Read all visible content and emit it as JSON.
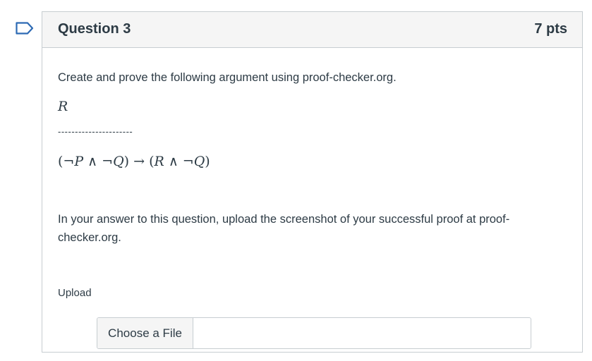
{
  "question": {
    "title": "Question 3",
    "points": "7 pts",
    "prompt": "Create and prove the following argument using proof-checker.org.",
    "premise": "R",
    "separator": "----------------------",
    "conclusion": {
      "open1": "(",
      "neg1": "¬",
      "p": "P",
      "and1": " ∧ ",
      "neg2": "¬",
      "q1": "Q",
      "close1": ")",
      "arrow": " → ",
      "open2": "(",
      "r": "R",
      "and2": " ∧ ",
      "neg3": "¬",
      "q2": "Q",
      "close2": ")"
    },
    "instruction": "In your answer to this question, upload the screenshot of your successful proof at proof-checker.org."
  },
  "upload": {
    "label": "Upload",
    "button_label": "Choose a File"
  },
  "colors": {
    "text": "#2d3b45",
    "border": "#c7cdd1",
    "header_bg": "#f5f5f5",
    "flag": "#2d6ab4"
  },
  "icons": {
    "flag": "bookmark-flag-icon"
  }
}
